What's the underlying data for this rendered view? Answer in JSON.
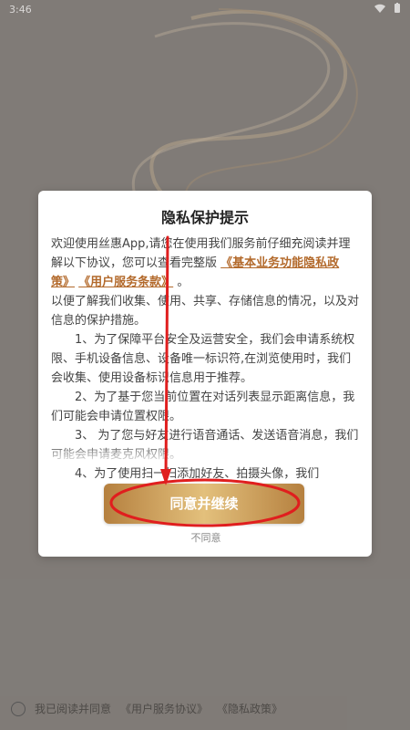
{
  "status_bar": {
    "time": "3:46",
    "wifi_icon": "wifi-icon",
    "battery_icon": "battery-icon"
  },
  "dialog": {
    "title": "隐私保护提示",
    "p1_a": "欢迎使用丝惠App,请您在使用我们服务前仔细充阅读并理解以下协议，您可以查看完整版",
    "link_privacy": "《基本业务功能隐私政策》",
    "link_terms": "《用户服务条款》",
    "p1_b": "。",
    "p2": "以便了解我们收集、使用、共享、存储信息的情况，以及对信息的保护措施。",
    "p3": "1、为了保障平台安全及运营安全，我们会申请系统权限、手机设备信息、设备唯一标识符,在浏览使用时，我们会收集、使用设备标识信息用于推荐。",
    "p4": "2、为了基于您当前位置在对话列表显示距离信息，我们可能会申请位置权限。",
    "p5": "3、 为了您与好友进行语音通话、发送语音消息，我们可能会申请麦克风权限。",
    "p6": "4、为了使用扫一扫添加好友、拍摄头像，我们"
  },
  "actions": {
    "agree": "同意并继续",
    "disagree": "不同意"
  },
  "bottom": {
    "prefix": "我已阅读并同意",
    "link1": "《用户服务协议》",
    "link2": "《隐私政策》"
  },
  "colors": {
    "accent": "#b36a2c",
    "annotation_red": "#e01e1e"
  }
}
